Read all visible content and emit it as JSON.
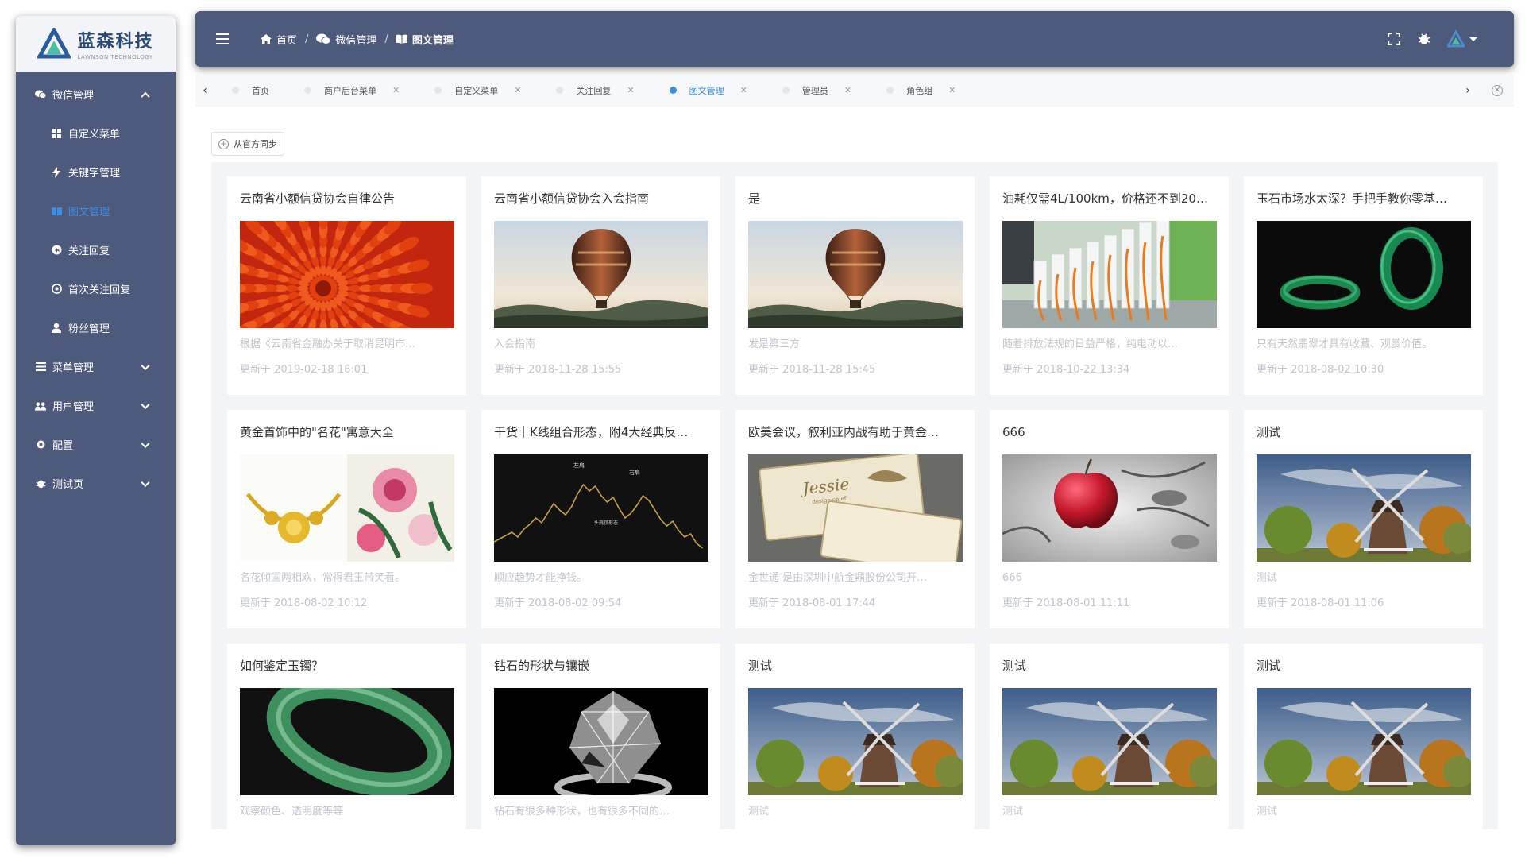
{
  "brand": {
    "name": "蓝森科技",
    "sub": "LAWNSON TECHNOLOGY"
  },
  "sidebar": {
    "items": [
      {
        "label": "微信管理",
        "icon": "wechat-icon",
        "expanded": true
      },
      {
        "label": "自定义菜单",
        "icon": "grid-icon",
        "sub": true
      },
      {
        "label": "关键字管理",
        "icon": "bolt-icon",
        "sub": true
      },
      {
        "label": "图文管理",
        "icon": "book-icon",
        "sub": true,
        "active": true
      },
      {
        "label": "关注回复",
        "icon": "reply-icon",
        "sub": true
      },
      {
        "label": "首次关注回复",
        "icon": "at-icon",
        "sub": true
      },
      {
        "label": "粉丝管理",
        "icon": "user-icon",
        "sub": true
      },
      {
        "label": "菜单管理",
        "icon": "menu-icon"
      },
      {
        "label": "用户管理",
        "icon": "users-icon"
      },
      {
        "label": "配置",
        "icon": "settings-icon"
      },
      {
        "label": "测试页",
        "icon": "bug-icon"
      }
    ]
  },
  "header": {
    "crumbs": [
      "首页",
      "微信管理",
      "图文管理"
    ],
    "separator": "/"
  },
  "tabs": [
    {
      "label": "首页",
      "closable": false
    },
    {
      "label": "商户后台菜单",
      "closable": true
    },
    {
      "label": "自定义菜单",
      "closable": true
    },
    {
      "label": "关注回复",
      "closable": true
    },
    {
      "label": "图文管理",
      "closable": true,
      "active": true
    },
    {
      "label": "管理员",
      "closable": true
    },
    {
      "label": "角色组",
      "closable": true
    }
  ],
  "toolbar": {
    "sync_label": "从官方同步"
  },
  "cards": [
    {
      "title": "云南省小额信贷协会自律公告",
      "image": "flower",
      "desc": "根据《云南省金融办关于取消昆明市…",
      "time": "更新于 2019-02-18 16:01"
    },
    {
      "title": "云南省小额信贷协会入会指南",
      "image": "balloon",
      "desc": "入会指南",
      "time": "更新于 2018-11-28 15:55"
    },
    {
      "title": "是",
      "image": "balloon",
      "desc": "发是第三方",
      "time": "更新于 2018-11-28 15:45"
    },
    {
      "title": "油耗仅需4L/100km，价格还不到20…",
      "image": "charging",
      "desc": "随着排放法规的日益严格，纯电动以…",
      "time": "更新于 2018-10-22 13:34"
    },
    {
      "title": "玉石市场水太深？手把手教你零基…",
      "image": "jade-rings",
      "desc": "只有天然翡翠才具有收藏、观赏价值。",
      "time": "更新于 2018-08-02 10:30"
    },
    {
      "title": "黄金首饰中的\"名花\"寓意大全",
      "image": "gold-peony",
      "desc": "名花倾国两相欢，常得君王带笑看。",
      "time": "更新于 2018-08-02 10:12"
    },
    {
      "title": "干货｜K线组合形态，附4大经典反…",
      "image": "kline",
      "desc": "顺应趋势才能挣钱。",
      "time": "更新于 2018-08-02 09:54"
    },
    {
      "title": "欧美会议，叙利亚内战有助于黄金…",
      "image": "card",
      "desc": "金世通 是由深圳中航金鼎股份公司开…",
      "time": "更新于 2018-08-01 17:44"
    },
    {
      "title": "666",
      "image": "apple",
      "desc": "666",
      "time": "更新于 2018-08-01 11:11"
    },
    {
      "title": "测试",
      "image": "windmill",
      "desc": "测试",
      "time": "更新于 2018-08-01 11:06"
    },
    {
      "title": "如何鉴定玉镯？",
      "image": "jade-bangle",
      "desc": "观察颜色、透明度等等",
      "time": ""
    },
    {
      "title": "钻石的形状与镶嵌",
      "image": "diamond",
      "desc": "钻石有很多种形状，也有很多不同的…",
      "time": ""
    },
    {
      "title": "测试",
      "image": "windmill",
      "desc": "测试",
      "time": ""
    },
    {
      "title": "测试",
      "image": "windmill",
      "desc": "测试",
      "time": ""
    },
    {
      "title": "测试",
      "image": "windmill",
      "desc": "测试",
      "time": ""
    }
  ],
  "kline_labels": [
    "左肩",
    "右肩",
    "头肩顶形态"
  ],
  "card_image_text": {
    "jessie": "Jessie",
    "jessie_sub": "design chief"
  },
  "colors": {
    "sidebar": "#4d5a7c",
    "accent": "#3a8ee6",
    "muted": "#c0c4cc"
  }
}
